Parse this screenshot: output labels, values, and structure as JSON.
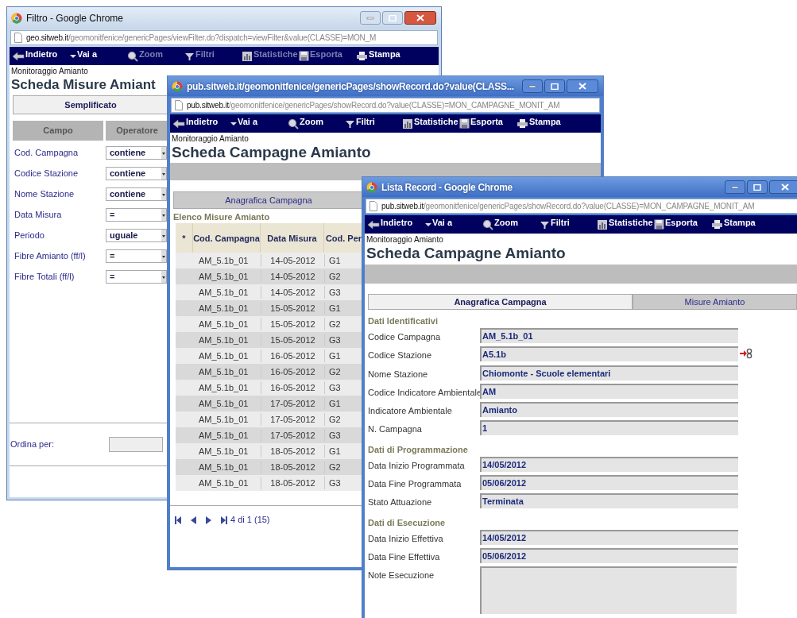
{
  "windows": [
    {
      "kind": "filter",
      "focused": false,
      "title": "Filtro - Google Chrome",
      "host": "geo.sitweb.it",
      "path": "/geomonitfenice/genericPages/viewFilter.do?dispatch=viewFilter&value(CLASSE)=MON_M",
      "toolbar": [
        {
          "kind": "back",
          "label": "Indietro",
          "disabled": false
        },
        {
          "kind": "goto",
          "label": "Vai a",
          "disabled": false
        },
        {
          "kind": "zoom",
          "label": "Zoom",
          "disabled": true
        },
        {
          "kind": "filter",
          "label": "Filtri",
          "disabled": true
        },
        {
          "kind": "stats",
          "label": "Statistiche",
          "disabled": true
        },
        {
          "kind": "export",
          "label": "Esporta",
          "disabled": true
        },
        {
          "kind": "print",
          "label": "Stampa",
          "disabled": false
        }
      ],
      "breadcrumb": "Monitoraggio Amianto",
      "heading": "Scheda Misure Amiant",
      "tabs": [
        {
          "label": "Semplificato",
          "selected": true
        }
      ],
      "columns": [
        "Campo",
        "Operatore"
      ],
      "rows": [
        {
          "label": "Cod. Campagna",
          "operator": "contiene"
        },
        {
          "label": "Codice Stazione",
          "operator": "contiene"
        },
        {
          "label": "Nome Stazione",
          "operator": "contiene"
        },
        {
          "label": "Data Misura",
          "operator": "="
        },
        {
          "label": "Periodo",
          "operator": "uguale"
        },
        {
          "label": "Fibre Amianto (ff/l)",
          "operator": "="
        },
        {
          "label": "Fibre Totali (ff/l)",
          "operator": "="
        }
      ],
      "order_label": "Ordina per:"
    },
    {
      "kind": "list",
      "focused": true,
      "title": "pub.sitweb.it/geomonitfenice/genericPages/showRecord.do?value(CLASS...",
      "host": "pub.sitweb.it",
      "path": "/geomonitfenice/genericPages/showRecord.do?value(CLASSE)=MON_CAMPAGNE_MONIT_AM",
      "toolbar": [
        {
          "kind": "back",
          "label": "Indietro",
          "disabled": false
        },
        {
          "kind": "goto",
          "label": "Vai a",
          "disabled": false
        },
        {
          "kind": "zoom",
          "label": "Zoom",
          "disabled": false
        },
        {
          "kind": "filter",
          "label": "Filtri",
          "disabled": false
        },
        {
          "kind": "stats",
          "label": "Statistiche",
          "disabled": false
        },
        {
          "kind": "export",
          "label": "Esporta",
          "disabled": false
        },
        {
          "kind": "print",
          "label": "Stampa",
          "disabled": false
        }
      ],
      "breadcrumb": "Monitoraggio Amianto",
      "heading": "Scheda Campagne Amianto",
      "tabs": [
        {
          "label": "Anagrafica Campagna",
          "selected": false
        }
      ],
      "list_title": "Elenco Misure Amianto",
      "columns": [
        "*",
        "Cod. Campagna",
        "Data Misura",
        "Cod. Per"
      ],
      "rows": [
        [
          "",
          "AM_5.1b_01",
          "14-05-2012",
          "G1"
        ],
        [
          "",
          "AM_5.1b_01",
          "14-05-2012",
          "G2"
        ],
        [
          "",
          "AM_5.1b_01",
          "14-05-2012",
          "G3"
        ],
        [
          "",
          "AM_5.1b_01",
          "15-05-2012",
          "G1"
        ],
        [
          "",
          "AM_5.1b_01",
          "15-05-2012",
          "G2"
        ],
        [
          "",
          "AM_5.1b_01",
          "15-05-2012",
          "G3"
        ],
        [
          "",
          "AM_5.1b_01",
          "16-05-2012",
          "G1"
        ],
        [
          "",
          "AM_5.1b_01",
          "16-05-2012",
          "G2"
        ],
        [
          "",
          "AM_5.1b_01",
          "16-05-2012",
          "G3"
        ],
        [
          "",
          "AM_5.1b_01",
          "17-05-2012",
          "G1"
        ],
        [
          "",
          "AM_5.1b_01",
          "17-05-2012",
          "G2"
        ],
        [
          "",
          "AM_5.1b_01",
          "17-05-2012",
          "G3"
        ],
        [
          "",
          "AM_5.1b_01",
          "18-05-2012",
          "G1"
        ],
        [
          "",
          "AM_5.1b_01",
          "18-05-2012",
          "G2"
        ],
        [
          "",
          "AM_5.1b_01",
          "18-05-2012",
          "G3"
        ]
      ],
      "pager": "4 di 1 (15)"
    },
    {
      "kind": "record",
      "focused": true,
      "title": "Lista Record - Google Chrome",
      "host": "pub.sitweb.it",
      "path": "/geomonitfenice/genericPages/showRecord.do?value(CLASSE)=MON_CAMPAGNE_MONIT_AM",
      "toolbar": [
        {
          "kind": "back",
          "label": "Indietro",
          "disabled": false
        },
        {
          "kind": "goto",
          "label": "Vai a",
          "disabled": false
        },
        {
          "kind": "zoom",
          "label": "Zoom",
          "disabled": false
        },
        {
          "kind": "filter",
          "label": "Filtri",
          "disabled": false
        },
        {
          "kind": "stats",
          "label": "Statistiche",
          "disabled": false
        },
        {
          "kind": "export",
          "label": "Esporta",
          "disabled": false
        },
        {
          "kind": "print",
          "label": "Stampa",
          "disabled": false
        }
      ],
      "breadcrumb": "Monitoraggio Amianto",
      "heading": "Scheda Campagne Amianto",
      "tabs": [
        {
          "label": "Anagrafica Campagna",
          "selected": true
        },
        {
          "label": "Misure Amianto",
          "selected": false
        }
      ],
      "sections": [
        {
          "title": "Dati Identificativi",
          "fields": [
            {
              "kind": "text",
              "label": "Codice Campagna",
              "value": "AM_5.1b_01",
              "link": false
            },
            {
              "kind": "text",
              "label": "Codice Stazione",
              "value": "A5.1b",
              "link": true
            },
            {
              "kind": "text",
              "label": "Nome Stazione",
              "value": "Chiomonte - Scuole elementari",
              "link": false
            },
            {
              "kind": "text",
              "label": "Codice Indicatore Ambientale",
              "value": "AM",
              "link": false
            },
            {
              "kind": "text",
              "label": "Indicatore Ambientale",
              "value": "Amianto",
              "link": false
            },
            {
              "kind": "text",
              "label": "N. Campagna",
              "value": "1",
              "link": false
            }
          ]
        },
        {
          "title": "Dati di Programmazione",
          "fields": [
            {
              "kind": "text",
              "label": "Data Inizio Programmata",
              "value": "14/05/2012",
              "link": false
            },
            {
              "kind": "text",
              "label": "Data Fine Programmata",
              "value": "05/06/2012",
              "link": false
            },
            {
              "kind": "text",
              "label": "Stato Attuazione",
              "value": "Terminata",
              "link": false
            }
          ]
        },
        {
          "title": "Dati di Esecuzione",
          "fields": [
            {
              "kind": "text",
              "label": "Data Inizio Effettiva",
              "value": "14/05/2012",
              "link": false
            },
            {
              "kind": "text",
              "label": "Data Fine Effettiva",
              "value": "05/06/2012",
              "link": false
            },
            {
              "kind": "textarea",
              "label": "Note Esecuzione",
              "link": false
            }
          ]
        }
      ]
    }
  ]
}
